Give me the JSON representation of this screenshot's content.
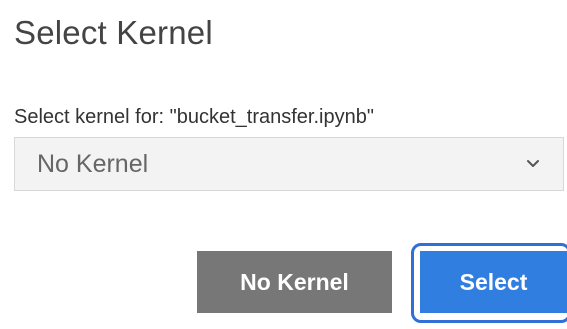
{
  "dialog": {
    "title": "Select Kernel",
    "prompt": "Select kernel for: \"bucket_transfer.ipynb\"",
    "kernel_select": {
      "selected": "No Kernel",
      "icon": "chevron-down-icon"
    },
    "buttons": {
      "no_kernel": "No Kernel",
      "select": "Select"
    },
    "colors": {
      "primary": "#2f7ee0",
      "secondary": "#777777",
      "focus_ring": "#2f6fd6"
    }
  }
}
